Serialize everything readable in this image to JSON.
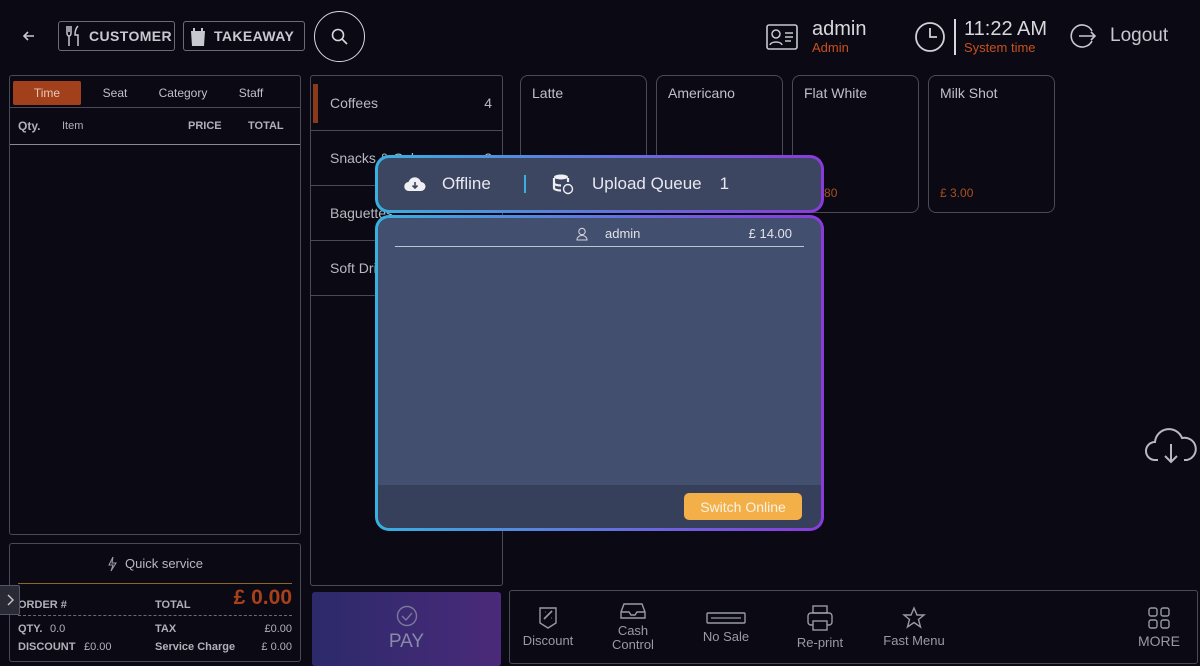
{
  "header": {
    "customer_label": "CUSTOMER",
    "takeaway_label": "TAKEAWAY",
    "user_name": "admin",
    "user_role": "Admin",
    "time": "11:22 AM",
    "time_caption": "System time",
    "logout_label": "Logout"
  },
  "order": {
    "sort_tabs": [
      "Time",
      "Seat",
      "Category",
      "Staff"
    ],
    "columns": {
      "qty": "Qty.",
      "item": "Item",
      "price": "PRICE",
      "total": "TOTAL"
    }
  },
  "summary": {
    "quick_service": "Quick service",
    "order_label": "ORDER #",
    "total_label": "TOTAL",
    "total_value": "£ 0.00",
    "qty_label": "QTY.",
    "qty_value": "0.0",
    "tax_label": "TAX",
    "tax_value": "£0.00",
    "discount_label": "DISCOUNT",
    "discount_value": "£0.00",
    "service_label": "Service Charge",
    "service_value": "£ 0.00"
  },
  "categories": [
    {
      "name": "Coffees",
      "count": "4"
    },
    {
      "name": "Snacks & Cakes",
      "count": "2"
    },
    {
      "name": "Baguettes",
      "count": ""
    },
    {
      "name": "Soft Drinks",
      "count": ""
    }
  ],
  "products": [
    {
      "name": "Latte",
      "price": ""
    },
    {
      "name": "Americano",
      "price": ""
    },
    {
      "name": "Flat White",
      "price": "£ 2.80"
    },
    {
      "name": "Milk Shot",
      "price": "£ 3.00"
    }
  ],
  "bottom": {
    "pay_label": "PAY",
    "tools": {
      "discount": "Discount",
      "cash_control": "Cash Control",
      "no_sale": "No Sale",
      "reprint": "Re-print",
      "fast_menu": "Fast Menu",
      "more": "MORE"
    }
  },
  "modal": {
    "offline_label": "Offline",
    "queue_label": "Upload Queue",
    "queue_count": "1",
    "rows": [
      {
        "user": "admin",
        "amount": "£ 14.00"
      }
    ],
    "switch_label": "Switch Online"
  },
  "colors": {
    "accent": "#a2401c",
    "modal_gradient_start": "#38b0e0",
    "modal_gradient_end": "#8a3adc",
    "switch_button": "#f4b048"
  }
}
